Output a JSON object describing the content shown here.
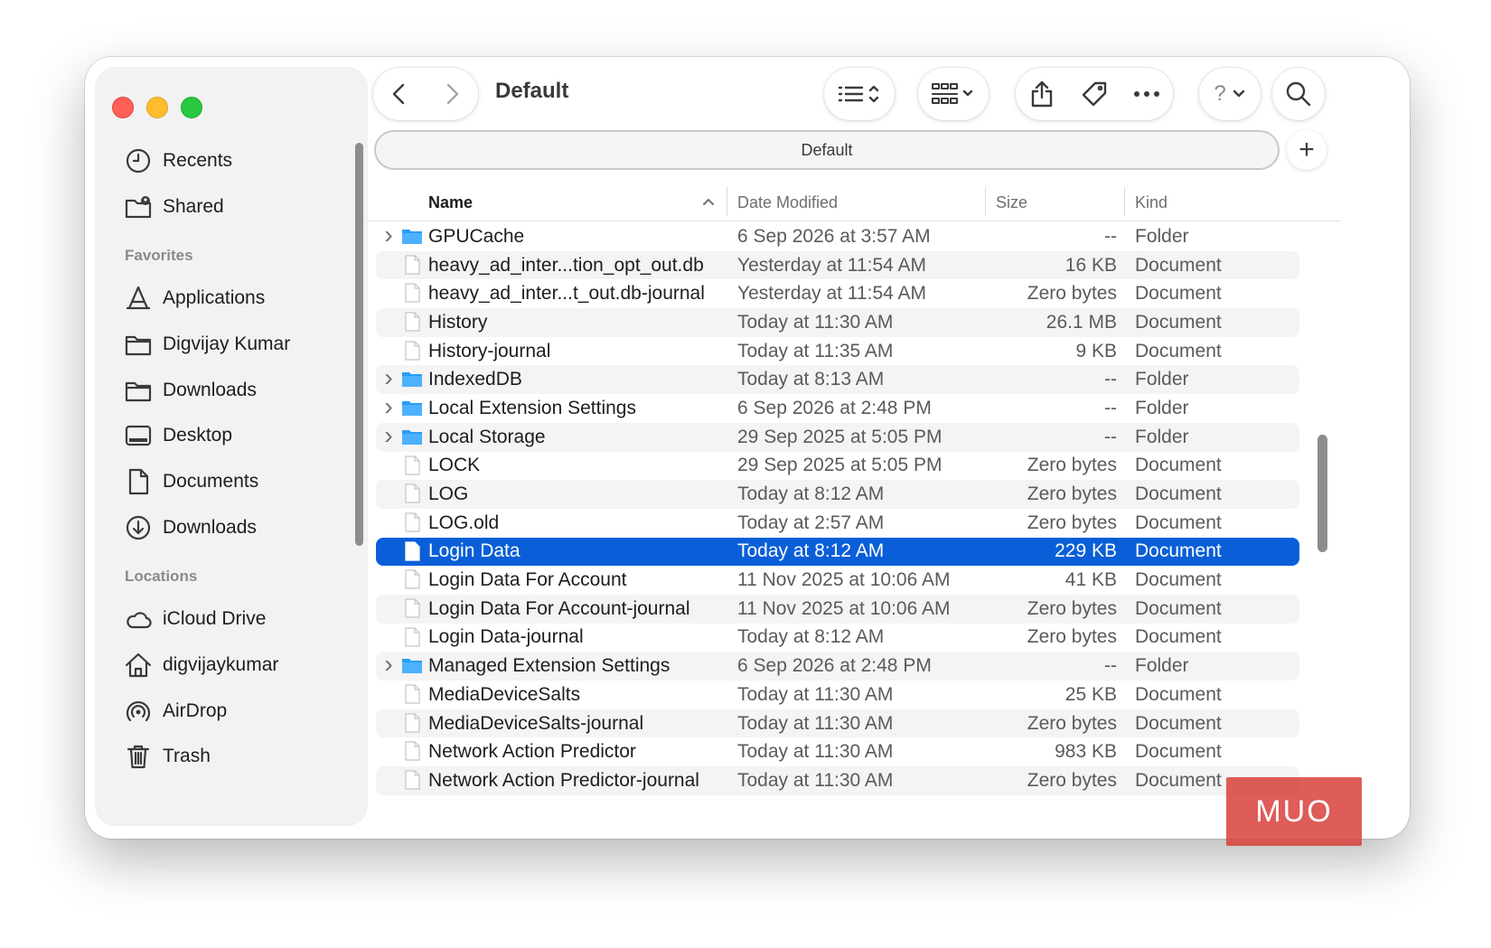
{
  "window": {
    "title": "Default",
    "path_label": "Default",
    "add_tab_label": "+"
  },
  "sidebar": {
    "top_items": [
      {
        "label": "Recents",
        "icon": "clock-icon"
      },
      {
        "label": "Shared",
        "icon": "shared-folder-icon"
      }
    ],
    "favorites_header": "Favorites",
    "favorites": [
      {
        "label": "Applications",
        "icon": "applications-icon"
      },
      {
        "label": "Digvijay Kumar",
        "icon": "folder-icon"
      },
      {
        "label": "Downloads",
        "icon": "folder-icon"
      },
      {
        "label": "Desktop",
        "icon": "desktop-icon"
      },
      {
        "label": "Documents",
        "icon": "document-icon"
      },
      {
        "label": "Downloads",
        "icon": "download-circle-icon"
      }
    ],
    "locations_header": "Locations",
    "locations": [
      {
        "label": "iCloud Drive",
        "icon": "cloud-icon"
      },
      {
        "label": "digvijaykumar",
        "icon": "home-icon"
      },
      {
        "label": "AirDrop",
        "icon": "airdrop-icon"
      },
      {
        "label": "Trash",
        "icon": "trash-icon"
      }
    ]
  },
  "toolbar": {
    "back": "chevron-left-icon",
    "forward": "chevron-right-icon",
    "view_options": "list-view-icon",
    "group_options": "grid-view-icon",
    "share": "share-icon",
    "tag": "tag-icon",
    "more": "more-icon",
    "help": "?",
    "search": "search-icon"
  },
  "columns": {
    "name": "Name",
    "date": "Date Modified",
    "size": "Size",
    "kind": "Kind"
  },
  "files": [
    {
      "name": "GPUCache",
      "date": "6 Sep 2026 at 3:57 AM",
      "size": "--",
      "kind": "Folder",
      "folder": true
    },
    {
      "name": "heavy_ad_inter...tion_opt_out.db",
      "date": "Yesterday at 11:54 AM",
      "size": "16 KB",
      "kind": "Document",
      "folder": false
    },
    {
      "name": "heavy_ad_inter...t_out.db-journal",
      "date": "Yesterday at 11:54 AM",
      "size": "Zero bytes",
      "kind": "Document",
      "folder": false
    },
    {
      "name": "History",
      "date": "Today at 11:30 AM",
      "size": "26.1 MB",
      "kind": "Document",
      "folder": false
    },
    {
      "name": "History-journal",
      "date": "Today at 11:35 AM",
      "size": "9 KB",
      "kind": "Document",
      "folder": false
    },
    {
      "name": "IndexedDB",
      "date": "Today at 8:13 AM",
      "size": "--",
      "kind": "Folder",
      "folder": true
    },
    {
      "name": "Local Extension Settings",
      "date": "6 Sep 2026 at 2:48 PM",
      "size": "--",
      "kind": "Folder",
      "folder": true
    },
    {
      "name": "Local Storage",
      "date": "29 Sep 2025 at 5:05 PM",
      "size": "--",
      "kind": "Folder",
      "folder": true
    },
    {
      "name": "LOCK",
      "date": "29 Sep 2025 at 5:05 PM",
      "size": "Zero bytes",
      "kind": "Document",
      "folder": false
    },
    {
      "name": "LOG",
      "date": "Today at 8:12 AM",
      "size": "Zero bytes",
      "kind": "Document",
      "folder": false
    },
    {
      "name": "LOG.old",
      "date": "Today at 2:57 AM",
      "size": "Zero bytes",
      "kind": "Document",
      "folder": false
    },
    {
      "name": "Login Data",
      "date": "Today at 8:12 AM",
      "size": "229 KB",
      "kind": "Document",
      "folder": false,
      "selected": true
    },
    {
      "name": "Login Data For Account",
      "date": "11 Nov 2025 at 10:06 AM",
      "size": "41 KB",
      "kind": "Document",
      "folder": false
    },
    {
      "name": "Login Data For Account-journal",
      "date": "11 Nov 2025 at 10:06 AM",
      "size": "Zero bytes",
      "kind": "Document",
      "folder": false
    },
    {
      "name": "Login Data-journal",
      "date": "Today at 8:12 AM",
      "size": "Zero bytes",
      "kind": "Document",
      "folder": false
    },
    {
      "name": "Managed Extension Settings",
      "date": "6 Sep 2026 at 2:48 PM",
      "size": "--",
      "kind": "Folder",
      "folder": true
    },
    {
      "name": "MediaDeviceSalts",
      "date": "Today at 11:30 AM",
      "size": "25 KB",
      "kind": "Document",
      "folder": false
    },
    {
      "name": "MediaDeviceSalts-journal",
      "date": "Today at 11:30 AM",
      "size": "Zero bytes",
      "kind": "Document",
      "folder": false
    },
    {
      "name": "Network Action Predictor",
      "date": "Today at 11:30 AM",
      "size": "983 KB",
      "kind": "Document",
      "folder": false
    },
    {
      "name": "Network Action Predictor-journal",
      "date": "Today at 11:30 AM",
      "size": "Zero bytes",
      "kind": "Document",
      "folder": false
    }
  ],
  "watermark": "MUO",
  "colors": {
    "selection": "#0a5fd8",
    "folder": "#2a9df4",
    "close": "#fe5f57",
    "minimize": "#febc2e",
    "zoom": "#28c840"
  }
}
